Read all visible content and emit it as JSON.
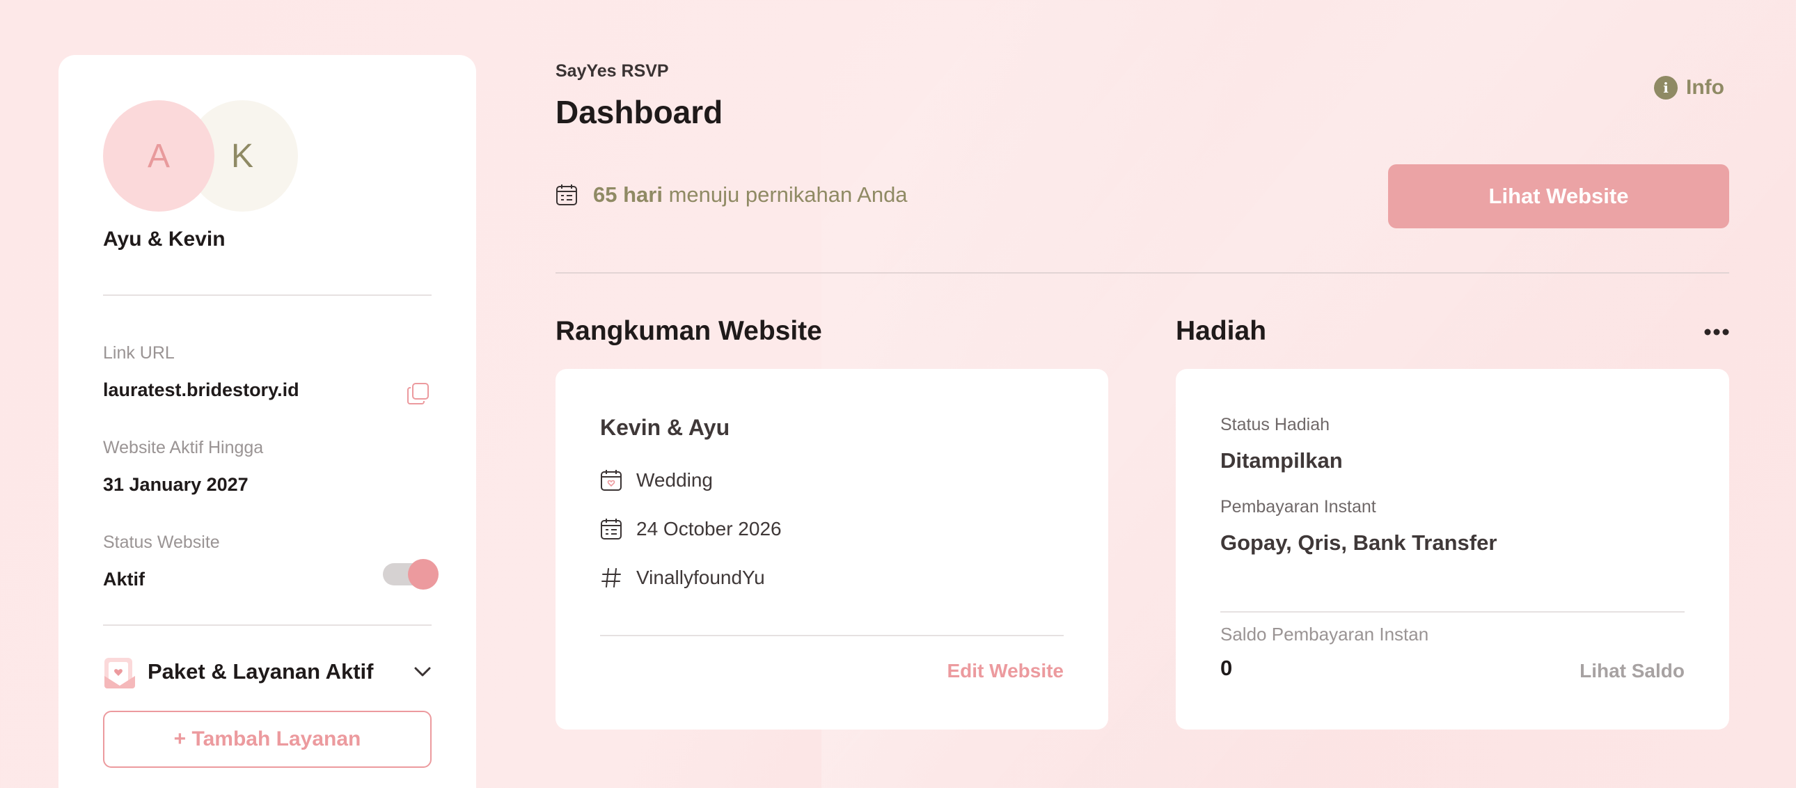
{
  "sidebar": {
    "avatar_a": "A",
    "avatar_k": "K",
    "couple_name": "Ayu & Kevin",
    "link_url_label": "Link URL",
    "link_url_value": "lauratest.bridestory.id",
    "active_until_label": "Website Aktif Hingga",
    "active_until_value": "31 January 2027",
    "status_label": "Status Website",
    "status_value": "Aktif",
    "status_on": true,
    "paket_title": "Paket & Layanan Aktif",
    "tambah_label": "+ Tambah Layanan"
  },
  "header": {
    "brand": "SayYes RSVP",
    "title": "Dashboard",
    "info_label": "Info",
    "countdown_days": "65 hari",
    "countdown_rest": " menuju pernikahan Anda",
    "view_website_label": "Lihat Website"
  },
  "summary": {
    "section_title": "Rangkuman Website",
    "name": "Kevin & Ayu",
    "event_type": "Wedding",
    "event_date": "24 October 2026",
    "hashtag": "VinallyfoundYu",
    "edit_label": "Edit Website"
  },
  "gift": {
    "section_title": "Hadiah",
    "status_label": "Status Hadiah",
    "status_value": "Ditampilkan",
    "payment_label": "Pembayaran Instant",
    "payment_value": "Gopay, Qris, Bank Transfer",
    "balance_label": "Saldo Pembayaran Instan",
    "balance_value": "0",
    "balance_link": "Lihat Saldo"
  },
  "colors": {
    "accent_pink": "#ec9a9e",
    "olive": "#8f8a64",
    "background": "#fde8e8"
  },
  "icons": {
    "copy": "copy-icon",
    "toggle": "toggle-switch",
    "paket": "invitation-card-icon",
    "chevron": "chevron-down-icon",
    "info": "info-icon",
    "calendar": "calendar-icon",
    "calendar_heart": "calendar-heart-icon",
    "hashtag": "hashtag-icon",
    "more": "more-horizontal-icon"
  }
}
